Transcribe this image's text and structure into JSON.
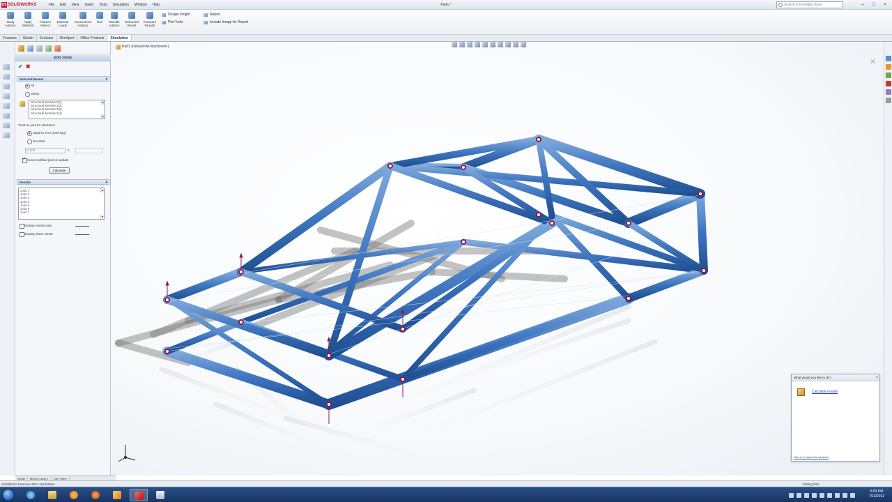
{
  "app": {
    "logo_text": "SOLIDWORKS",
    "document_title": "Part1 *",
    "menu": [
      "File",
      "Edit",
      "View",
      "Insert",
      "Tools",
      "Simulation",
      "Window",
      "Help"
    ],
    "search_placeholder": "Search Knowledge Base"
  },
  "ribbon": {
    "buttons": [
      {
        "label": "Study Advisor",
        "icon": "study-advisor-icon"
      },
      {
        "label": "Apply Material",
        "icon": "apply-material-icon"
      },
      {
        "label": "Fixtures Advisor",
        "icon": "fixtures-advisor-icon"
      },
      {
        "label": "External Loads",
        "icon": "external-loads-icon"
      },
      {
        "label": "Connections Advisor",
        "icon": "connections-advisor-icon"
      },
      {
        "label": "Run",
        "icon": "run-icon"
      },
      {
        "label": "Results Advisor",
        "icon": "results-advisor-icon"
      },
      {
        "label": "Deformed Result",
        "icon": "deformed-result-icon"
      },
      {
        "label": "Compare Results",
        "icon": "compare-results-icon"
      }
    ],
    "small_buttons": [
      "Design Insight",
      "Plot Tools",
      "Report",
      "Include Image for Report"
    ]
  },
  "tabs": [
    "Features",
    "Sketch",
    "Evaluate",
    "DimXpert",
    "Office Products",
    "Simulation"
  ],
  "active_tab": "Simulation",
  "panel": {
    "title": "Edit Joints",
    "selected_beams": {
      "header": "Selected Beams",
      "options": [
        "All",
        "Select"
      ],
      "beams": [
        "Structural Member1[1]",
        "Structural Member1[2]",
        "Structural Member1[3]",
        "Structural Member1[4]"
      ]
    },
    "treat_as_joint": {
      "label": "Treat as joint for clearance",
      "options": [
        "equal to zero (touching)",
        "less than"
      ],
      "tolerance_value": "0.000",
      "keep_modified_label": "Keep modified joint on update",
      "calculate_label": "Calculate"
    },
    "results": {
      "header": "Results",
      "joints": [
        "Joint 1",
        "Joint 2",
        "Joint 3",
        "Joint 4",
        "Joint 5",
        "Joint 6",
        "Joint 7"
      ],
      "checkboxes": [
        "Display neutral axis",
        "Display shear center"
      ]
    },
    "bottom_tabs": [
      "Model",
      "Motion Study 1",
      "Top Frame"
    ]
  },
  "viewport": {
    "tree_label": "Part1 (Default<As Machined>)"
  },
  "help_popup": {
    "title": "What would you like to do?",
    "link": "Calculate results",
    "footer": "How do I close this window?"
  },
  "status": {
    "left": "SolidWorks Premium 2012 x64 Edition",
    "right": "Editing Part"
  },
  "taskbar": {
    "time": "5:53 PM",
    "date": "7/16/2012"
  },
  "colors": {
    "frame_blue": "#3f78c0",
    "joint_marker": "#8a1c4a",
    "accent": "#c8102e"
  }
}
